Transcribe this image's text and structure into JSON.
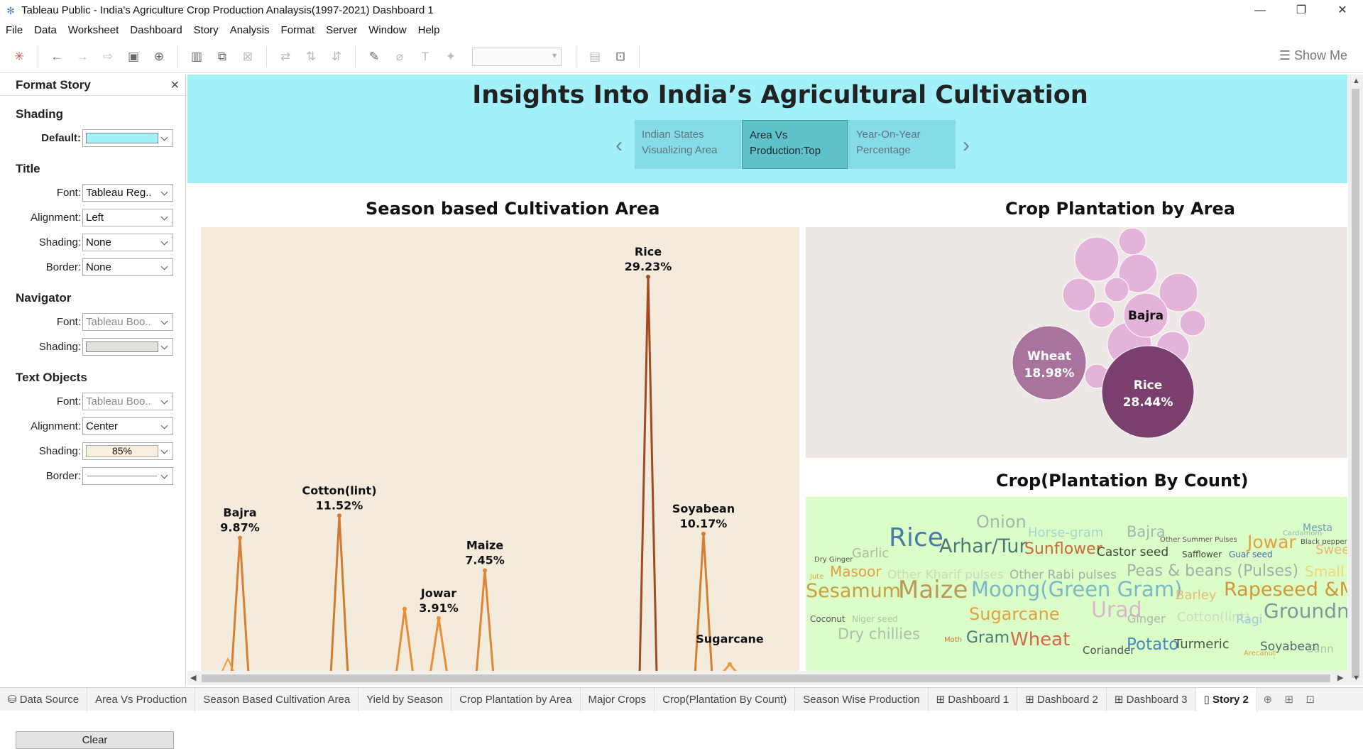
{
  "window": {
    "title": "Tableau Public - India's Agriculture Crop Production Analaysis(1997-2021) Dashboard 1"
  },
  "menu": [
    "File",
    "Data",
    "Worksheet",
    "Dashboard",
    "Story",
    "Analysis",
    "Format",
    "Server",
    "Window",
    "Help"
  ],
  "toolbar": {
    "show_me": "Show Me"
  },
  "format_panel": {
    "title": "Format Story",
    "sections": {
      "shading": "Shading",
      "title": "Title",
      "navigator": "Navigator",
      "text_objects": "Text Objects"
    },
    "shading_default_label": "Default:",
    "shading_default_color": "#a1f0fa",
    "title_rows": [
      {
        "label": "Font:",
        "value": "Tableau Reg.."
      },
      {
        "label": "Alignment:",
        "value": "Left"
      },
      {
        "label": "Shading:",
        "value": "None"
      },
      {
        "label": "Border:",
        "value": "None"
      }
    ],
    "navigator_font_label": "Font:",
    "navigator_font_value": "Tableau Boo..",
    "navigator_shading_label": "Shading:",
    "navigator_shading_color": "#e0e0dc",
    "text_font_label": "Font:",
    "text_font_value": "Tableau Boo..",
    "text_alignment_label": "Alignment:",
    "text_alignment_value": "Center",
    "text_shading_label": "Shading:",
    "text_shading_value": "85%",
    "text_border_label": "Border:",
    "clear_label": "Clear"
  },
  "story": {
    "title": "Insights Into India’s  Agricultural Cultivation",
    "nav": [
      {
        "line1": "Indian States",
        "line2": "Visualizing Area"
      },
      {
        "line1": "Area Vs",
        "line2": "Production:Top"
      },
      {
        "line1": "Year-On-Year",
        "line2": "Percentage"
      }
    ]
  },
  "sheets": {
    "season_title": "Season based Cultivation Area",
    "crop_area_title": "Crop Plantation by Area",
    "crop_count_title": "Crop(Plantation  By Count)"
  },
  "chart_data": [
    {
      "type": "line",
      "title": "Season based Cultivation Area",
      "peaks": [
        {
          "name": "Bajra",
          "value": 9.87,
          "label": "9.87%"
        },
        {
          "name": "Cotton(lint)",
          "value": 11.52,
          "label": "11.52%"
        },
        {
          "name": "",
          "value": 4.6,
          "label": ""
        },
        {
          "name": "Jowar",
          "value": 3.91,
          "label": "3.91%"
        },
        {
          "name": "Maize",
          "value": 7.45,
          "label": "7.45%"
        },
        {
          "name": "Rice",
          "value": 29.23,
          "label": "29.23%"
        },
        {
          "name": "Soyabean",
          "value": 10.17,
          "label": "10.17%"
        },
        {
          "name": "Sugarcane",
          "value": 0.5,
          "label": ""
        }
      ],
      "colors": {
        "low": "#f39a3c",
        "high": "#a24a22"
      }
    },
    {
      "type": "bubble",
      "title": "Crop Plantation by Area",
      "labeled": [
        {
          "name": "Rice",
          "value": 28.44,
          "label": "28.44%",
          "color": "#7b3f6e"
        },
        {
          "name": "Wheat",
          "value": 18.98,
          "label": "18.98%",
          "color": "#a8739d"
        },
        {
          "name": "Bajra",
          "label": "",
          "color": "#e4b3da"
        }
      ],
      "bubble_color": "#e4b3da"
    }
  ],
  "word_cloud": [
    {
      "t": "Onion",
      "s": 24,
      "c": "#a0b8b0"
    },
    {
      "t": "Horse-gram",
      "s": 18,
      "c": "#a8d4d0"
    },
    {
      "t": "Bajra",
      "s": 21,
      "c": "#a0b8b0"
    },
    {
      "t": "Other Summer Pulses",
      "s": 10,
      "c": "#555"
    },
    {
      "t": "Cardamom",
      "s": 10,
      "c": "#8ab8b0"
    },
    {
      "t": "Mesta",
      "s": 14,
      "c": "#6a9ab8"
    },
    {
      "t": "Black pepper",
      "s": 10,
      "c": "#555"
    },
    {
      "t": "Dry Ginger",
      "s": 10,
      "c": "#555"
    },
    {
      "t": "Garlic",
      "s": 18,
      "c": "#a8c0a0"
    },
    {
      "t": "Rice",
      "s": 36,
      "c": "#4a7aa8"
    },
    {
      "t": "Arhar/Tur",
      "s": 27,
      "c": "#4a7a78"
    },
    {
      "t": "Sunflower",
      "s": 22,
      "c": "#c86a3a"
    },
    {
      "t": "Castor seed",
      "s": 17,
      "c": "#3a4a3a"
    },
    {
      "t": "Safflower",
      "s": 12,
      "c": "#3a4a3a"
    },
    {
      "t": "Guar seed",
      "s": 12,
      "c": "#4a6aa8"
    },
    {
      "t": "Jowar",
      "s": 25,
      "c": "#e0a040"
    },
    {
      "t": "Sweet p",
      "s": 18,
      "c": "#f0b070"
    },
    {
      "t": "Jute",
      "s": 10,
      "c": "#e0a040"
    },
    {
      "t": "Masoor",
      "s": 20,
      "c": "#e0a040"
    },
    {
      "t": "Other Kharif pulses",
      "s": 17,
      "c": "#c8dcb8"
    },
    {
      "t": "Other Rabi pulses",
      "s": 17,
      "c": "#a0b0a8"
    },
    {
      "t": "Peas & beans (Pulses)",
      "s": 22,
      "c": "#a0b0a8"
    },
    {
      "t": "Small",
      "s": 20,
      "c": "#f0d870"
    },
    {
      "t": "Sesamum",
      "s": 27,
      "c": "#c8a040"
    },
    {
      "t": "Maize",
      "s": 34,
      "c": "#b89a58"
    },
    {
      "t": "Moong(Green Gram)",
      "s": 29,
      "c": "#7ab8c8"
    },
    {
      "t": "Barley",
      "s": 18,
      "c": "#e8b878"
    },
    {
      "t": "Rapeseed &Mu",
      "s": 27,
      "c": "#d09838"
    },
    {
      "t": "Coconut",
      "s": 12,
      "c": "#555"
    },
    {
      "t": "Niger seed",
      "s": 12,
      "c": "#a8c898"
    },
    {
      "t": "Sugarcane",
      "s": 24,
      "c": "#e0a040"
    },
    {
      "t": "Urad",
      "s": 30,
      "c": "#d8b8c8"
    },
    {
      "t": "Ginger",
      "s": 16,
      "c": "#a8b8a8"
    },
    {
      "t": "Cotton(lint)",
      "s": 18,
      "c": "#c8dcc8"
    },
    {
      "t": "Ragi",
      "s": 17,
      "c": "#a0c8d8"
    },
    {
      "t": "Groundnu",
      "s": 28,
      "c": "#7a9aa0"
    },
    {
      "t": "Dry chillies",
      "s": 21,
      "c": "#a8c0a8"
    },
    {
      "t": "Moth",
      "s": 10,
      "c": "#d07040"
    },
    {
      "t": "Gram",
      "s": 22,
      "c": "#4a7a78"
    },
    {
      "t": "Wheat",
      "s": 26,
      "c": "#d06a4a"
    },
    {
      "t": "Coriander",
      "s": 15,
      "c": "#555"
    },
    {
      "t": "Potato",
      "s": 23,
      "c": "#4a88c0"
    },
    {
      "t": "Turmeric",
      "s": 18,
      "c": "#4a5a4a"
    },
    {
      "t": "Arecanut",
      "s": 10,
      "c": "#e0a040"
    },
    {
      "t": "Soyabean",
      "s": 17,
      "c": "#4a6a68"
    },
    {
      "t": "Sann",
      "s": 15,
      "c": "#a8c8a8"
    }
  ],
  "tabs": [
    "Data Source",
    "Area Vs Production",
    "Season Based Cultivation Area",
    "Yield by Season",
    "Crop Plantation by Area",
    "Major Crops",
    "Crop(Plantation By Count)",
    "Season Wise Production",
    "Dashboard 1",
    "Dashboard 2",
    "Dashboard 3",
    "Story 2"
  ]
}
